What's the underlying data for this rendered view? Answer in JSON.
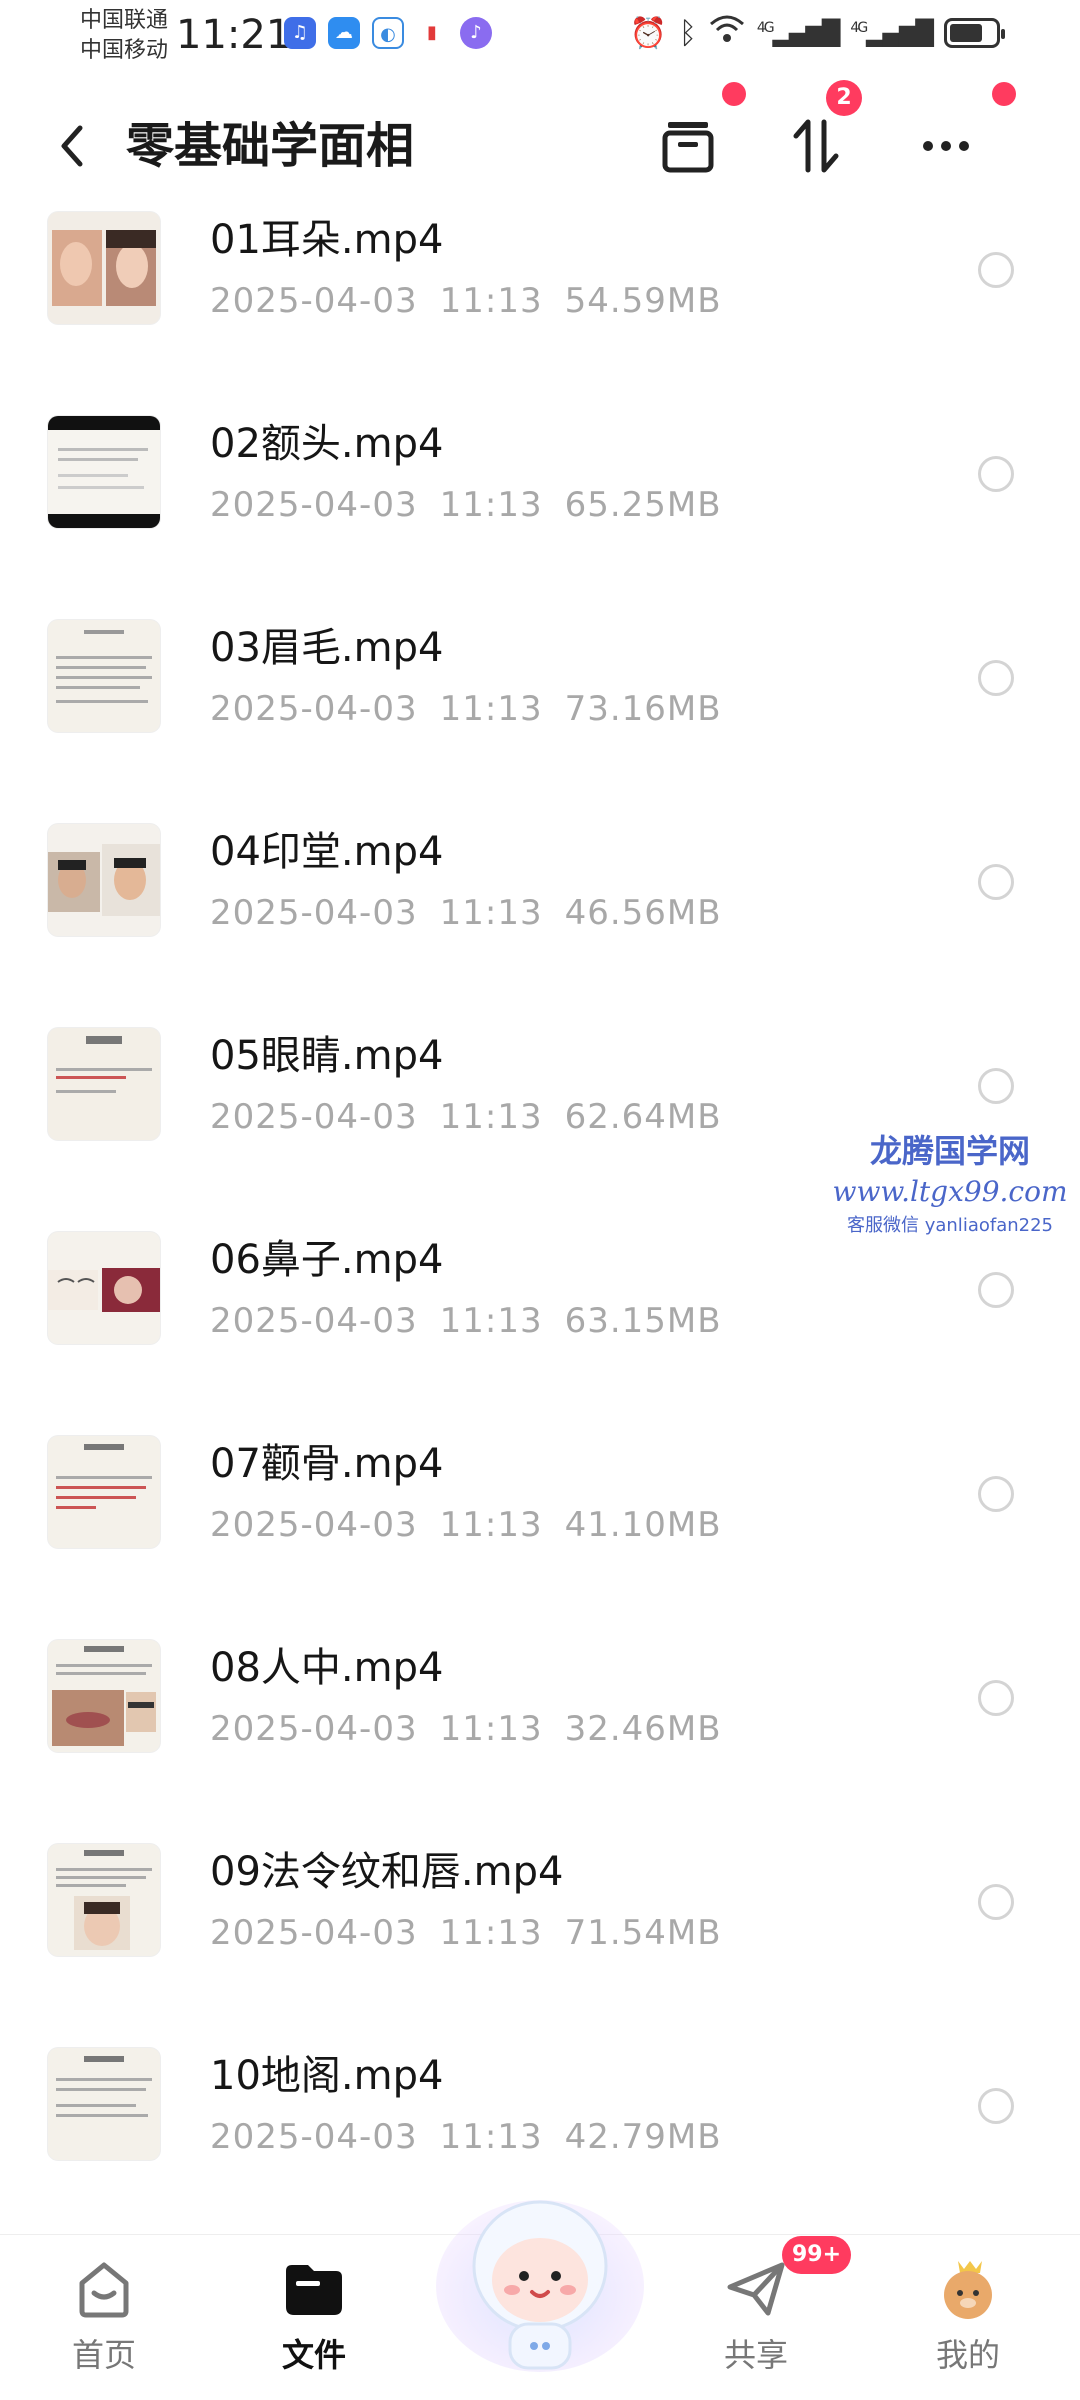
{
  "status_bar": {
    "carrier_1": "中国联通",
    "carrier_2": "中国移动",
    "time": "11:21",
    "network_1": "4G",
    "network_2": "4G",
    "battery_level": 0.72
  },
  "header": {
    "title": "零基础学面相",
    "transfer_badge": "2",
    "icons": [
      "back-icon",
      "archive-icon",
      "transfer-icon",
      "more-icon"
    ]
  },
  "files": [
    {
      "name": "01耳朵.mp4",
      "date": "2025-04-03",
      "time": "11:13",
      "size": "54.59MB"
    },
    {
      "name": "02额头.mp4",
      "date": "2025-04-03",
      "time": "11:13",
      "size": "65.25MB"
    },
    {
      "name": "03眉毛.mp4",
      "date": "2025-04-03",
      "time": "11:13",
      "size": "73.16MB"
    },
    {
      "name": "04印堂.mp4",
      "date": "2025-04-03",
      "time": "11:13",
      "size": "46.56MB"
    },
    {
      "name": "05眼睛.mp4",
      "date": "2025-04-03",
      "time": "11:13",
      "size": "62.64MB"
    },
    {
      "name": "06鼻子.mp4",
      "date": "2025-04-03",
      "time": "11:13",
      "size": "63.15MB"
    },
    {
      "name": "07颧骨.mp4",
      "date": "2025-04-03",
      "time": "11:13",
      "size": "41.10MB"
    },
    {
      "name": "08人中.mp4",
      "date": "2025-04-03",
      "time": "11:13",
      "size": "32.46MB"
    },
    {
      "name": "09法令纹和唇.mp4",
      "date": "2025-04-03",
      "time": "11:13",
      "size": "71.54MB"
    },
    {
      "name": "10地阁.mp4",
      "date": "2025-04-03",
      "time": "11:13",
      "size": "42.79MB"
    }
  ],
  "watermark": {
    "title": "龙腾国学网",
    "url": "www.ltgx99.com",
    "contact": "客服微信 yanliaofan225"
  },
  "tabs": {
    "home": "首页",
    "files": "文件",
    "share": "共享",
    "mine": "我的",
    "share_badge": "99+"
  },
  "colors": {
    "accent_red": "#ff3b5f",
    "meta_gray": "#a8a8a8",
    "watermark_blue": "#4a66c9"
  }
}
